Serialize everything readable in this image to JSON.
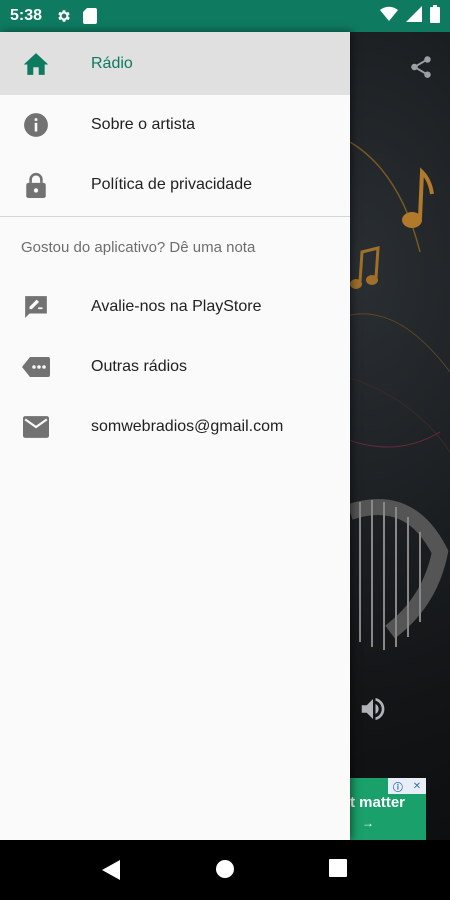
{
  "status_bar": {
    "time": "5:38",
    "left_icons": [
      "settings-icon",
      "sd-card-icon"
    ],
    "right_icons": [
      "wifi-icon",
      "signal-icon",
      "battery-icon"
    ],
    "color": "#0e7a60"
  },
  "drawer": {
    "items": [
      {
        "label": "Rádio",
        "icon": "home-icon",
        "active": true
      },
      {
        "label": "Sobre o artista",
        "icon": "info-icon",
        "active": false
      },
      {
        "label": "Política de privacidade",
        "icon": "lock-icon",
        "active": false
      }
    ],
    "section_header": "Gostou do aplicativo? Dê uma nota",
    "section_items": [
      {
        "label": "Avalie-nos na PlayStore",
        "icon": "rate-review-icon"
      },
      {
        "label": "Outras rádios",
        "icon": "label-more-icon"
      },
      {
        "label": "somwebradios@gmail.com",
        "icon": "email-icon"
      }
    ],
    "accent_color": "#0e7a60"
  },
  "background_app": {
    "ad_text": "t matter",
    "ad_arrow": "→"
  },
  "nav_bar": {
    "buttons": [
      "back-icon",
      "home-circle-icon",
      "recents-icon"
    ]
  }
}
